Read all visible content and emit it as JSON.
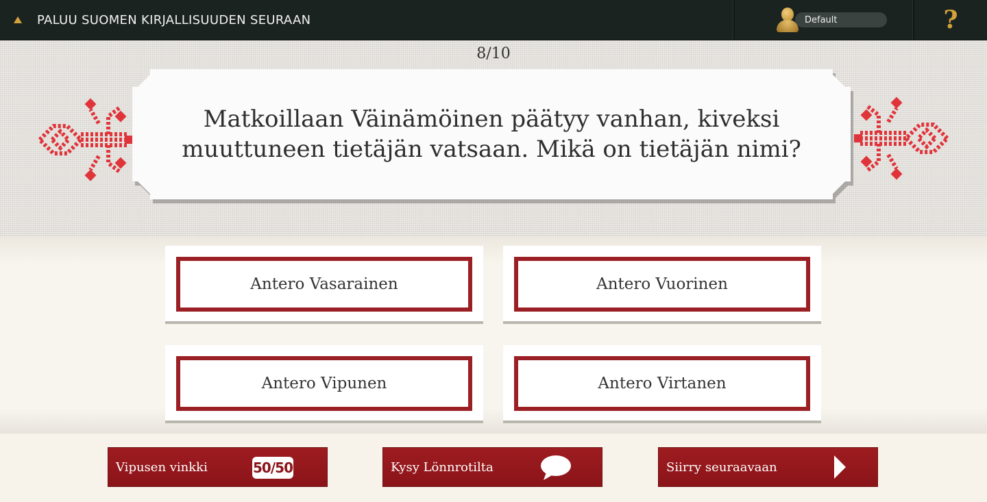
{
  "topbar": {
    "back_label": "PALUU SUOMEN KIRJALLISUUDEN SEURAAN",
    "profile_name": "Default",
    "help_label": "?"
  },
  "quiz": {
    "counter": "8/10",
    "question": "Matkoillaan Väinämöinen päätyy vanhan, kiveksi muuttuneen tietäjän vatsaan. Mikä on tietäjän nimi?",
    "answers": [
      "Antero Vasarainen",
      "Antero Vuorinen",
      "Antero Vipunen",
      "Antero Virtanen"
    ]
  },
  "actions": {
    "hint_label": "Vipusen vinkki",
    "hint_badge": "50/50",
    "ask_label": "Kysy Lönnrotilta",
    "next_label": "Siirry seuraavaan"
  },
  "icons": {
    "back": "triangle-up-icon",
    "profile": "avatar-icon",
    "help": "question-mark-icon",
    "ask": "speech-bubble-icon",
    "next": "play-arrow-icon"
  },
  "colors": {
    "topbar_bg": "#1b2321",
    "accent_gold": "#d4a23a",
    "brand_red": "#9b2025",
    "ornament_red": "#e0343b"
  }
}
